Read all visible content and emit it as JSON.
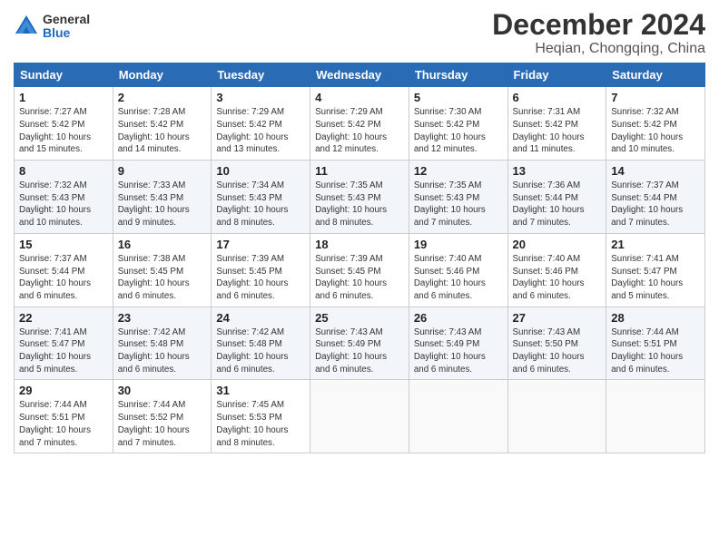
{
  "logo": {
    "general": "General",
    "blue": "Blue"
  },
  "title": "December 2024",
  "location": "Heqian, Chongqing, China",
  "weekdays": [
    "Sunday",
    "Monday",
    "Tuesday",
    "Wednesday",
    "Thursday",
    "Friday",
    "Saturday"
  ],
  "weeks": [
    [
      {
        "day": "1",
        "info": "Sunrise: 7:27 AM\nSunset: 5:42 PM\nDaylight: 10 hours\nand 15 minutes."
      },
      {
        "day": "2",
        "info": "Sunrise: 7:28 AM\nSunset: 5:42 PM\nDaylight: 10 hours\nand 14 minutes."
      },
      {
        "day": "3",
        "info": "Sunrise: 7:29 AM\nSunset: 5:42 PM\nDaylight: 10 hours\nand 13 minutes."
      },
      {
        "day": "4",
        "info": "Sunrise: 7:29 AM\nSunset: 5:42 PM\nDaylight: 10 hours\nand 12 minutes."
      },
      {
        "day": "5",
        "info": "Sunrise: 7:30 AM\nSunset: 5:42 PM\nDaylight: 10 hours\nand 12 minutes."
      },
      {
        "day": "6",
        "info": "Sunrise: 7:31 AM\nSunset: 5:42 PM\nDaylight: 10 hours\nand 11 minutes."
      },
      {
        "day": "7",
        "info": "Sunrise: 7:32 AM\nSunset: 5:42 PM\nDaylight: 10 hours\nand 10 minutes."
      }
    ],
    [
      {
        "day": "8",
        "info": "Sunrise: 7:32 AM\nSunset: 5:43 PM\nDaylight: 10 hours\nand 10 minutes."
      },
      {
        "day": "9",
        "info": "Sunrise: 7:33 AM\nSunset: 5:43 PM\nDaylight: 10 hours\nand 9 minutes."
      },
      {
        "day": "10",
        "info": "Sunrise: 7:34 AM\nSunset: 5:43 PM\nDaylight: 10 hours\nand 8 minutes."
      },
      {
        "day": "11",
        "info": "Sunrise: 7:35 AM\nSunset: 5:43 PM\nDaylight: 10 hours\nand 8 minutes."
      },
      {
        "day": "12",
        "info": "Sunrise: 7:35 AM\nSunset: 5:43 PM\nDaylight: 10 hours\nand 7 minutes."
      },
      {
        "day": "13",
        "info": "Sunrise: 7:36 AM\nSunset: 5:44 PM\nDaylight: 10 hours\nand 7 minutes."
      },
      {
        "day": "14",
        "info": "Sunrise: 7:37 AM\nSunset: 5:44 PM\nDaylight: 10 hours\nand 7 minutes."
      }
    ],
    [
      {
        "day": "15",
        "info": "Sunrise: 7:37 AM\nSunset: 5:44 PM\nDaylight: 10 hours\nand 6 minutes."
      },
      {
        "day": "16",
        "info": "Sunrise: 7:38 AM\nSunset: 5:45 PM\nDaylight: 10 hours\nand 6 minutes."
      },
      {
        "day": "17",
        "info": "Sunrise: 7:39 AM\nSunset: 5:45 PM\nDaylight: 10 hours\nand 6 minutes."
      },
      {
        "day": "18",
        "info": "Sunrise: 7:39 AM\nSunset: 5:45 PM\nDaylight: 10 hours\nand 6 minutes."
      },
      {
        "day": "19",
        "info": "Sunrise: 7:40 AM\nSunset: 5:46 PM\nDaylight: 10 hours\nand 6 minutes."
      },
      {
        "day": "20",
        "info": "Sunrise: 7:40 AM\nSunset: 5:46 PM\nDaylight: 10 hours\nand 6 minutes."
      },
      {
        "day": "21",
        "info": "Sunrise: 7:41 AM\nSunset: 5:47 PM\nDaylight: 10 hours\nand 5 minutes."
      }
    ],
    [
      {
        "day": "22",
        "info": "Sunrise: 7:41 AM\nSunset: 5:47 PM\nDaylight: 10 hours\nand 5 minutes."
      },
      {
        "day": "23",
        "info": "Sunrise: 7:42 AM\nSunset: 5:48 PM\nDaylight: 10 hours\nand 6 minutes."
      },
      {
        "day": "24",
        "info": "Sunrise: 7:42 AM\nSunset: 5:48 PM\nDaylight: 10 hours\nand 6 minutes."
      },
      {
        "day": "25",
        "info": "Sunrise: 7:43 AM\nSunset: 5:49 PM\nDaylight: 10 hours\nand 6 minutes."
      },
      {
        "day": "26",
        "info": "Sunrise: 7:43 AM\nSunset: 5:49 PM\nDaylight: 10 hours\nand 6 minutes."
      },
      {
        "day": "27",
        "info": "Sunrise: 7:43 AM\nSunset: 5:50 PM\nDaylight: 10 hours\nand 6 minutes."
      },
      {
        "day": "28",
        "info": "Sunrise: 7:44 AM\nSunset: 5:51 PM\nDaylight: 10 hours\nand 6 minutes."
      }
    ],
    [
      {
        "day": "29",
        "info": "Sunrise: 7:44 AM\nSunset: 5:51 PM\nDaylight: 10 hours\nand 7 minutes."
      },
      {
        "day": "30",
        "info": "Sunrise: 7:44 AM\nSunset: 5:52 PM\nDaylight: 10 hours\nand 7 minutes."
      },
      {
        "day": "31",
        "info": "Sunrise: 7:45 AM\nSunset: 5:53 PM\nDaylight: 10 hours\nand 8 minutes."
      },
      {
        "day": "",
        "info": ""
      },
      {
        "day": "",
        "info": ""
      },
      {
        "day": "",
        "info": ""
      },
      {
        "day": "",
        "info": ""
      }
    ]
  ]
}
